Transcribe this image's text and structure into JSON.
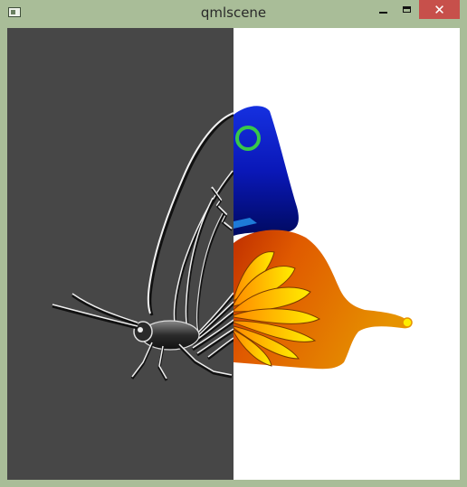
{
  "window": {
    "title": "qmlscene",
    "close_glyph": "✕"
  },
  "icons": {
    "app": "app-window-icon",
    "minimize": "minimize-icon",
    "maximize": "maximize-icon",
    "close": "close-icon"
  },
  "colors": {
    "frame": "#a9bd98",
    "close_button": "#c7504b",
    "left_panel": "#474747",
    "right_panel": "#ffffff",
    "wing_blue": "#0a14c8",
    "wing_orange": "#e07a00",
    "ring_green": "#38c84a"
  }
}
